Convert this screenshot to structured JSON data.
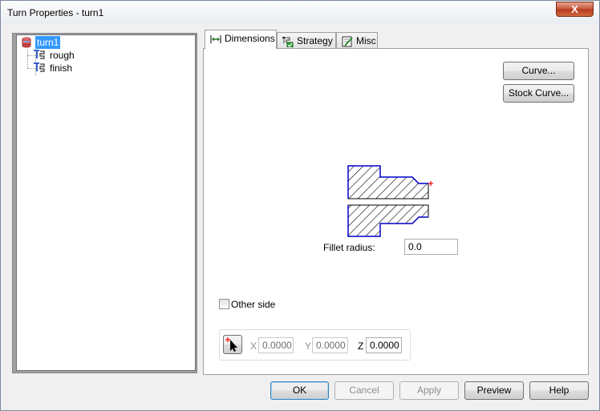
{
  "window": {
    "title": "Turn Properties - turn1",
    "close_glyph": "X"
  },
  "tree": {
    "items": [
      {
        "label": "turn1",
        "icon": "turn-stock-icon",
        "selected": true
      },
      {
        "label": "rough",
        "icon": "toolpath-icon",
        "selected": false
      },
      {
        "label": "finish",
        "icon": "toolpath-icon",
        "selected": false
      }
    ]
  },
  "tabs": [
    {
      "label": "Dimensions",
      "icon": "dimension-arrows-icon",
      "active": true
    },
    {
      "label": "Strategy",
      "icon": "strategy-icon",
      "active": false
    },
    {
      "label": "Misc",
      "icon": "misc-icon",
      "active": false
    }
  ],
  "dimensions": {
    "curve_button": "Curve...",
    "stock_curve_button": "Stock Curve...",
    "fillet_label": "Fillet radius:",
    "fillet_value": "0.0",
    "other_side_label": "Other side",
    "other_side_checked": false,
    "pick_icon": "pick-point-icon",
    "x_label": "X",
    "x_value": "0.0000",
    "y_label": "Y",
    "y_value": "0.0000",
    "z_label": "Z",
    "z_value": "0.0000"
  },
  "footer": {
    "ok": "OK",
    "cancel": "Cancel",
    "apply": "Apply",
    "preview": "Preview",
    "help": "Help"
  },
  "colors": {
    "selection": "#3399ff",
    "profile_outline": "#0000cc",
    "marker": "#ff0000",
    "close_button": "#c45536"
  }
}
